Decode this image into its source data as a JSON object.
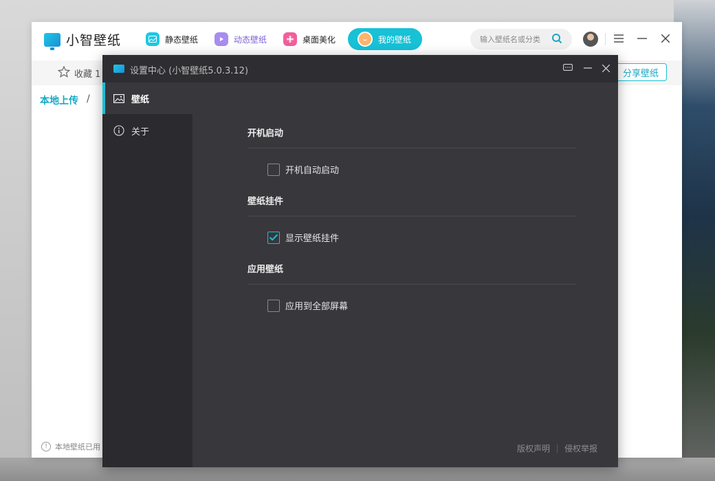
{
  "app": {
    "title": "小智壁纸",
    "nav": [
      {
        "label": "静态壁纸",
        "icon": "image-icon",
        "color": "#1ec8e5"
      },
      {
        "label": "动态壁纸",
        "icon": "play-icon",
        "color": "#a88cf0"
      },
      {
        "label": "桌面美化",
        "icon": "flower-icon",
        "color": "#f0609a"
      },
      {
        "label": "我的壁纸",
        "icon": "smile-icon",
        "color": "#17c1d6",
        "active": true
      }
    ],
    "search_placeholder": "输入壁纸名或分类",
    "favorites_label": "收藏 1",
    "share_button": "分享壁纸",
    "breadcrumb_root": "本地上传",
    "breadcrumb_sep": "/",
    "footer_note": "本地壁纸已用"
  },
  "dialog": {
    "title": "设置中心 (小智壁纸5.0.3.12)",
    "sidebar": [
      {
        "label": "壁纸",
        "icon": "image-icon",
        "active": true
      },
      {
        "label": "关于",
        "icon": "info-icon",
        "active": false
      }
    ],
    "sections": [
      {
        "title": "开机启动",
        "option": "开机自动启动",
        "checked": false
      },
      {
        "title": "壁纸挂件",
        "option": "显示壁纸挂件",
        "checked": true
      },
      {
        "title": "应用壁纸",
        "option": "应用到全部屏幕",
        "checked": false
      }
    ],
    "footer": {
      "copyright": "版权声明",
      "report": "侵权举报"
    }
  },
  "colors": {
    "accent": "#17c1d6",
    "dialog_bg": "#38373c",
    "sidebar_bg": "#2b2a2e"
  }
}
